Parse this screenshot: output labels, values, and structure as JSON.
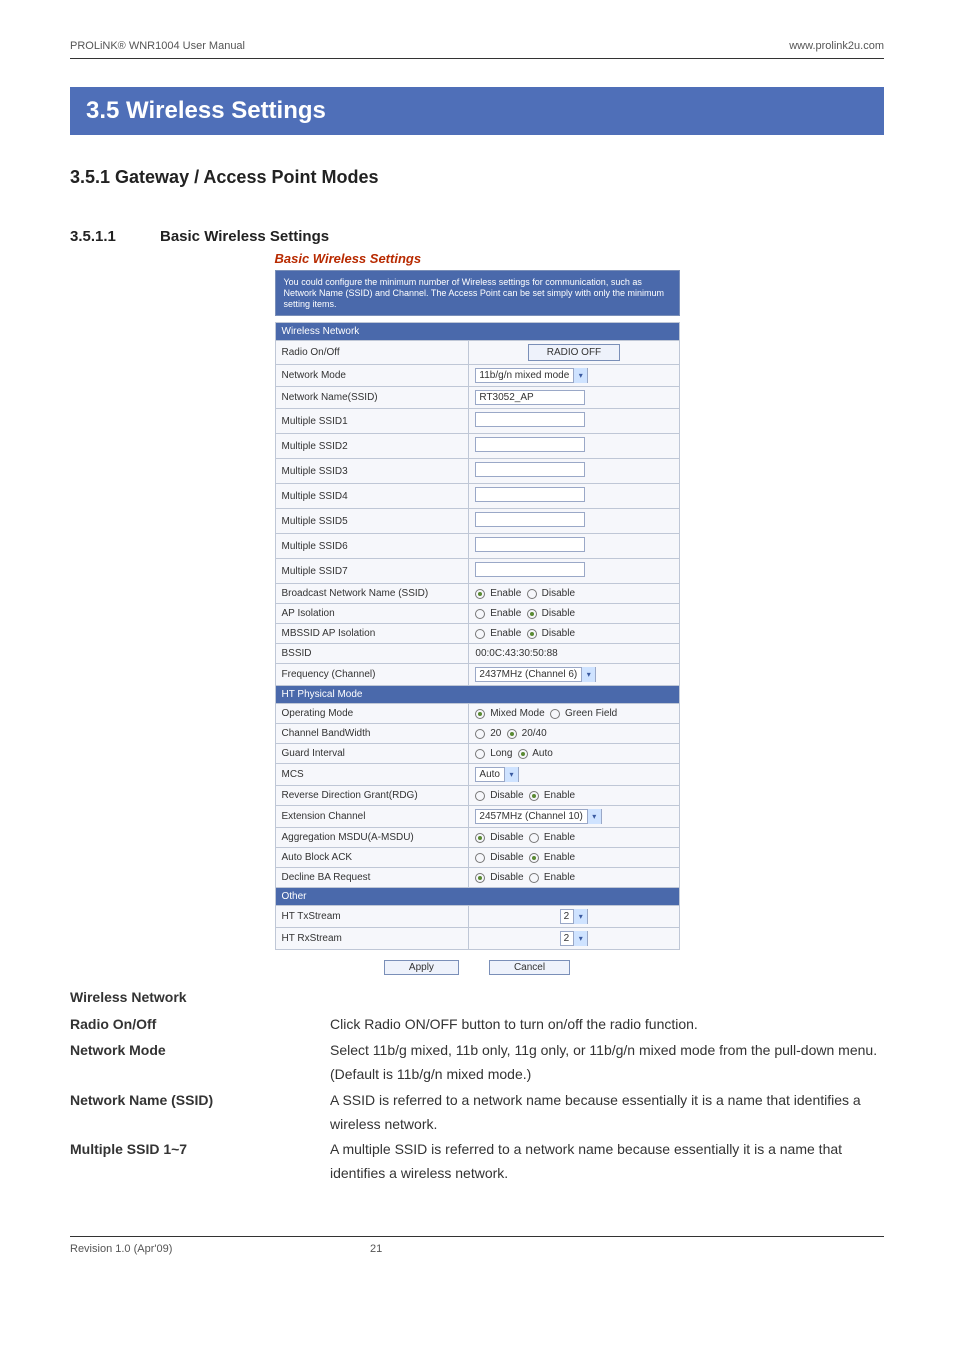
{
  "header": {
    "left": "PROLiNK® WNR1004 User Manual",
    "right": "www.prolink2u.com"
  },
  "section_banner": "3.5  Wireless Settings",
  "sub1": "3.5.1  Gateway / Access Point Modes",
  "sub2_num": "3.5.1.1",
  "sub2_title": "Basic Wireless Settings",
  "embed": {
    "title": "Basic Wireless Settings",
    "intro": "You could configure the minimum number of Wireless settings for communication, such as Network Name (SSID) and Channel. The Access Point can be set simply with only the minimum setting items.",
    "sec_wireless": "Wireless Network",
    "rows": {
      "radio": {
        "label": "Radio On/Off",
        "btn": "RADIO OFF"
      },
      "netmode": {
        "label": "Network Mode",
        "value": "11b/g/n mixed mode"
      },
      "ssid": {
        "label": "Network Name(SSID)",
        "value": "RT3052_AP"
      },
      "m1": {
        "label": "Multiple SSID1",
        "value": ""
      },
      "m2": {
        "label": "Multiple SSID2",
        "value": ""
      },
      "m3": {
        "label": "Multiple SSID3",
        "value": ""
      },
      "m4": {
        "label": "Multiple SSID4",
        "value": ""
      },
      "m5": {
        "label": "Multiple SSID5",
        "value": ""
      },
      "m6": {
        "label": "Multiple SSID6",
        "value": ""
      },
      "m7": {
        "label": "Multiple SSID7",
        "value": ""
      },
      "broadcast": {
        "label": "Broadcast Network Name (SSID)",
        "opt1": "Enable",
        "opt2": "Disable"
      },
      "apiso": {
        "label": "AP Isolation",
        "opt1": "Enable",
        "opt2": "Disable"
      },
      "mbssid": {
        "label": "MBSSID AP Isolation",
        "opt1": "Enable",
        "opt2": "Disable"
      },
      "bssid": {
        "label": "BSSID",
        "value": "00:0C:43:30:50:88"
      },
      "freq": {
        "label": "Frequency (Channel)",
        "value": "2437MHz (Channel 6)"
      }
    },
    "sec_ht": "HT Physical Mode",
    "ht": {
      "opmode": {
        "label": "Operating Mode",
        "opt1": "Mixed Mode",
        "opt2": "Green Field"
      },
      "bw": {
        "label": "Channel BandWidth",
        "opt1": "20",
        "opt2": "20/40"
      },
      "gi": {
        "label": "Guard Interval",
        "opt1": "Long",
        "opt2": "Auto"
      },
      "mcs": {
        "label": "MCS",
        "value": "Auto"
      },
      "rdg": {
        "label": "Reverse Direction Grant(RDG)",
        "opt1": "Disable",
        "opt2": "Enable"
      },
      "ext": {
        "label": "Extension Channel",
        "value": "2457MHz (Channel 10)"
      },
      "agg": {
        "label": "Aggregation MSDU(A-MSDU)",
        "opt1": "Disable",
        "opt2": "Enable"
      },
      "ack": {
        "label": "Auto Block ACK",
        "opt1": "Disable",
        "opt2": "Enable"
      },
      "ba": {
        "label": "Decline BA Request",
        "opt1": "Disable",
        "opt2": "Enable"
      }
    },
    "sec_other": "Other",
    "other": {
      "tx": {
        "label": "HT TxStream",
        "value": "2"
      },
      "rx": {
        "label": "HT RxStream",
        "value": "2"
      }
    },
    "apply": "Apply",
    "cancel": "Cancel"
  },
  "desc": {
    "heading": "Wireless Network",
    "radio": {
      "t": "Radio On/Off",
      "d": "Click Radio ON/OFF button to turn on/off the radio function."
    },
    "netmode": {
      "t": "Network Mode",
      "d": "Select 11b/g mixed, 11b only, 11g only, or 11b/g/n mixed mode from the pull-down menu. (Default is 11b/g/n mixed mode.)"
    },
    "ssid": {
      "t": "Network Name (SSID)",
      "d": "A SSID is referred to a network name because essentially it is a name that identifies a wireless network."
    },
    "multi": {
      "t": "Multiple SSID 1~7",
      "d": "A multiple SSID is referred to a network name because essentially it is a name that identifies a wireless network."
    }
  },
  "footer": {
    "rev": "Revision 1.0 (Apr'09)",
    "page": "21"
  }
}
